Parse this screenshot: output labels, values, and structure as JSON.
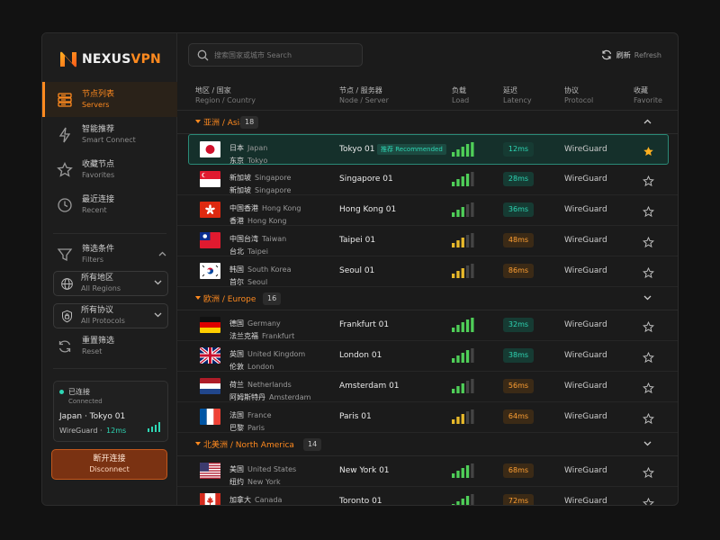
{
  "app": {
    "brand_main": "NEXUS",
    "brand_accent": "VPN",
    "accent_color": "#ff8a1f",
    "good_color": "#2ed6b4"
  },
  "sidebar": {
    "nav": [
      {
        "zh": "节点列表",
        "en": "Servers",
        "icon": "server-list-icon",
        "active": true
      },
      {
        "zh": "智能推荐",
        "en": "Smart Connect",
        "icon": "lightning-icon",
        "active": false
      },
      {
        "zh": "收藏节点",
        "en": "Favorites",
        "icon": "star-icon",
        "active": false
      },
      {
        "zh": "最近连接",
        "en": "Recent",
        "icon": "clock-icon",
        "active": false
      }
    ],
    "filters": {
      "zh": "筛选条件",
      "en": "Filters"
    },
    "region_filter": {
      "zh": "所有地区",
      "en": "All Regions"
    },
    "protocol_filter": {
      "zh": "所有协议",
      "en": "All Protocols"
    },
    "reset": {
      "zh": "重置筛选",
      "en": "Reset"
    },
    "connection": {
      "status_zh": "已连接",
      "status_en": "Connected",
      "location": "Japan · Tokyo 01",
      "protocol": "WireGuard",
      "separator": "·",
      "latency": "12ms",
      "signal_bars": 4
    },
    "disconnect": {
      "zh": "断开连接",
      "en": "Disconnect"
    }
  },
  "main": {
    "search_placeholder": "搜索国家或城市  Search",
    "refresh": {
      "zh": "刷新",
      "en": "Refresh"
    },
    "columns": [
      {
        "zh": "地区 / 国家",
        "en": "Region / Country"
      },
      {
        "zh": "节点 / 服务器",
        "en": "Node / Server"
      },
      {
        "zh": "负载",
        "en": "Load"
      },
      {
        "zh": "延迟",
        "en": "Latency"
      },
      {
        "zh": "协议",
        "en": "Protocol"
      },
      {
        "zh": "收藏",
        "en": "Favorite"
      }
    ],
    "groups": [
      {
        "name": "亚洲 / Asia",
        "count": "18",
        "expanded": true,
        "rows": [
          {
            "country_zh": "日本",
            "country_en": "Japan",
            "city_zh": "东京",
            "city_en": "Tokyo",
            "flag": "jp",
            "node": "Tokyo 01",
            "recommended": "推荐 Recommended",
            "load": 5,
            "load_level": "good",
            "latency": "12ms",
            "latency_level": "good",
            "protocol": "WireGuard",
            "favorite": true,
            "selected": true
          },
          {
            "country_zh": "新加坡",
            "country_en": "Singapore",
            "city_zh": "新加坡",
            "city_en": "Singapore",
            "flag": "sg",
            "node": "Singapore 01",
            "load": 4,
            "load_level": "good",
            "latency": "28ms",
            "latency_level": "good",
            "protocol": "WireGuard",
            "favorite": false
          },
          {
            "country_zh": "中国香港",
            "country_en": "Hong Kong",
            "city_zh": "香港",
            "city_en": "Hong Kong",
            "flag": "hk",
            "node": "Hong Kong 01",
            "load": 3,
            "load_level": "mixed",
            "latency": "36ms",
            "latency_level": "good",
            "protocol": "WireGuard",
            "favorite": false
          },
          {
            "country_zh": "中国台湾",
            "country_en": "Taiwan",
            "city_zh": "台北",
            "city_en": "Taipei",
            "flag": "tw",
            "node": "Taipei 01",
            "load": 3,
            "load_level": "warn",
            "latency": "48ms",
            "latency_level": "warn",
            "protocol": "WireGuard",
            "favorite": false
          },
          {
            "country_zh": "韩国",
            "country_en": "South Korea",
            "city_zh": "首尔",
            "city_en": "Seoul",
            "flag": "kr",
            "node": "Seoul 01",
            "load": 3,
            "load_level": "warn",
            "latency": "86ms",
            "latency_level": "warn",
            "protocol": "WireGuard",
            "favorite": false
          }
        ]
      },
      {
        "name": "欧洲 / Europe",
        "count": "16",
        "expanded": false,
        "rows": [
          {
            "country_zh": "德国",
            "country_en": "Germany",
            "city_zh": "法兰克福",
            "city_en": "Frankfurt",
            "flag": "de",
            "node": "Frankfurt 01",
            "load": 5,
            "load_level": "good",
            "latency": "32ms",
            "latency_level": "good",
            "protocol": "WireGuard",
            "favorite": false
          },
          {
            "country_zh": "英国",
            "country_en": "United Kingdom",
            "city_zh": "伦敦",
            "city_en": "London",
            "flag": "gb",
            "node": "London 01",
            "load": 4,
            "load_level": "good",
            "latency": "38ms",
            "latency_level": "good",
            "protocol": "WireGuard",
            "favorite": false
          },
          {
            "country_zh": "荷兰",
            "country_en": "Netherlands",
            "city_zh": "阿姆斯特丹",
            "city_en": "Amsterdam",
            "flag": "nl",
            "node": "Amsterdam 01",
            "load": 3,
            "load_level": "mixed",
            "latency": "56ms",
            "latency_level": "warn",
            "protocol": "WireGuard",
            "favorite": false
          },
          {
            "country_zh": "法国",
            "country_en": "France",
            "city_zh": "巴黎",
            "city_en": "Paris",
            "flag": "fr",
            "node": "Paris 01",
            "load": 3,
            "load_level": "warn",
            "latency": "64ms",
            "latency_level": "warn",
            "protocol": "WireGuard",
            "favorite": false
          }
        ]
      },
      {
        "name": "北美洲 / North America",
        "count": "14",
        "expanded": false,
        "rows": [
          {
            "country_zh": "美国",
            "country_en": "United States",
            "city_zh": "纽约",
            "city_en": "New York",
            "flag": "us",
            "node": "New York 01",
            "load": 4,
            "load_level": "good",
            "latency": "68ms",
            "latency_level": "warn",
            "protocol": "WireGuard",
            "favorite": false
          },
          {
            "country_zh": "加拿大",
            "country_en": "Canada",
            "city_zh": "多伦多",
            "city_en": "Toronto",
            "flag": "ca",
            "node": "Toronto 01",
            "load": 4,
            "load_level": "good",
            "latency": "72ms",
            "latency_level": "warn",
            "protocol": "WireGuard",
            "favorite": false
          }
        ]
      }
    ]
  }
}
